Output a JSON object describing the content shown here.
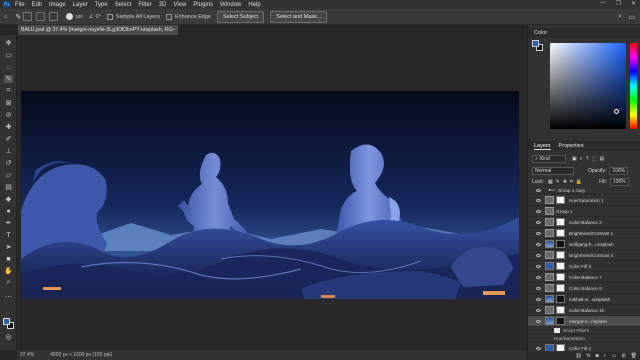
{
  "menu": {
    "items": [
      "File",
      "Edit",
      "Image",
      "Layer",
      "Type",
      "Select",
      "Filter",
      "3D",
      "View",
      "Plugins",
      "Window",
      "Help"
    ],
    "window_controls": [
      "—",
      "❐",
      "✕"
    ]
  },
  "options_bar": {
    "size_value": "100",
    "angle_value": "0°",
    "sample_all_layers": "Sample All Layers",
    "enhance_edge": "Enhance Edge",
    "select_subject": "Select Subject",
    "select_and_mask": "Select and Mask..."
  },
  "document": {
    "tab_title": "BALU.psd @ 37.4% (margot-noyelle-3Lg3OlOknPY-unsplash, RGB/8) *",
    "tab_close": "×"
  },
  "status": {
    "zoom": "37.4%",
    "dimensions": "4000 px x 1600 px (150 ppi)"
  },
  "panels": {
    "color_tab": "Color",
    "layers_tab": "Layers",
    "properties_tab": "Properties",
    "kind_label": "Kind",
    "blend_mode": "Normal",
    "opacity_label": "Opacity:",
    "opacity_value": "100%",
    "lock_label": "Lock:",
    "fill_label": "Fill:",
    "fill_value": "100%"
  },
  "layers": [
    {
      "name": "Group 1 copy",
      "type": "group"
    },
    {
      "name": "Hue/Saturation 1",
      "type": "adj"
    },
    {
      "name": "Group 1",
      "type": "group"
    },
    {
      "name": "Color Balance 2",
      "type": "adj"
    },
    {
      "name": "Brightness/Contrast 1",
      "type": "adj"
    },
    {
      "name": "wolfgang-h...unsplash",
      "type": "img"
    },
    {
      "name": "Brightness/Contrast 4",
      "type": "adj"
    },
    {
      "name": "Color Fill 3",
      "type": "fill"
    },
    {
      "name": "Color Balance 7",
      "type": "adj"
    },
    {
      "name": "Color Balance 8",
      "type": "adj"
    },
    {
      "name": "mikhail-vi...unsplash",
      "type": "img"
    },
    {
      "name": "Color Balance 10",
      "type": "adj"
    },
    {
      "name": "margot-n...nsplash",
      "type": "img",
      "selected": true
    },
    {
      "name": "Smart Filters",
      "type": "sub"
    },
    {
      "name": "Hue/Saturation",
      "type": "sub"
    },
    {
      "name": "Color Fill 2",
      "type": "fill"
    }
  ],
  "colors": {
    "foreground": "#2a5fae",
    "background": "#111111",
    "sky_top": "#060a1c",
    "sky_bottom": "#3f6fb8",
    "statue": "#5b78c8"
  }
}
